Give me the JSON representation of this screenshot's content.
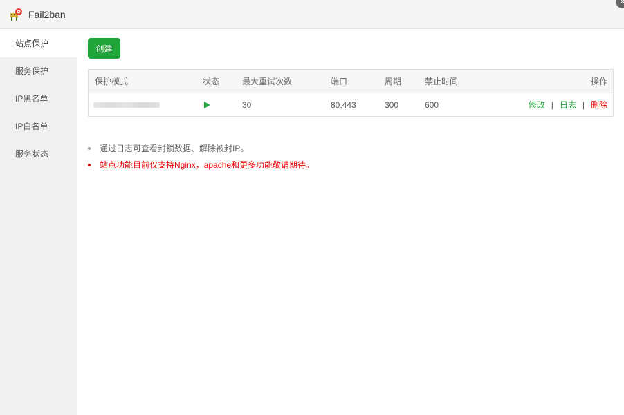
{
  "window": {
    "title": "Fail2ban",
    "app_icon": "fail2ban-app-icon",
    "close_icon": "close-icon"
  },
  "sidebar": {
    "items": [
      {
        "label": "站点保护",
        "active": true
      },
      {
        "label": "服务保护",
        "active": false
      },
      {
        "label": "IP黑名单",
        "active": false
      },
      {
        "label": "IP白名单",
        "active": false
      },
      {
        "label": "服务状态",
        "active": false
      }
    ]
  },
  "main": {
    "create_label": "创建",
    "table": {
      "headers": {
        "mode": "保护模式",
        "status": "状态",
        "max_retry": "最大重试次数",
        "port": "端口",
        "cycle": "周期",
        "ban_time": "禁止时间",
        "ops": "操作"
      },
      "rows": [
        {
          "status_icon": "play-icon",
          "max_retry": "30",
          "port": "80,443",
          "cycle": "300",
          "ban_time": "600",
          "ops": {
            "edit": "修改",
            "sep": "|",
            "log": "日志",
            "delete": "删除"
          }
        }
      ]
    },
    "tips": [
      "通过日志可查看封锁数据、解除被封IP。",
      "站点功能目前仅支持Nginx，apache和更多功能敬请期待。"
    ]
  },
  "colors": {
    "accent_green": "#20a53a",
    "danger_red": "#e60000",
    "sidebar_bg": "#f0f0f0"
  }
}
